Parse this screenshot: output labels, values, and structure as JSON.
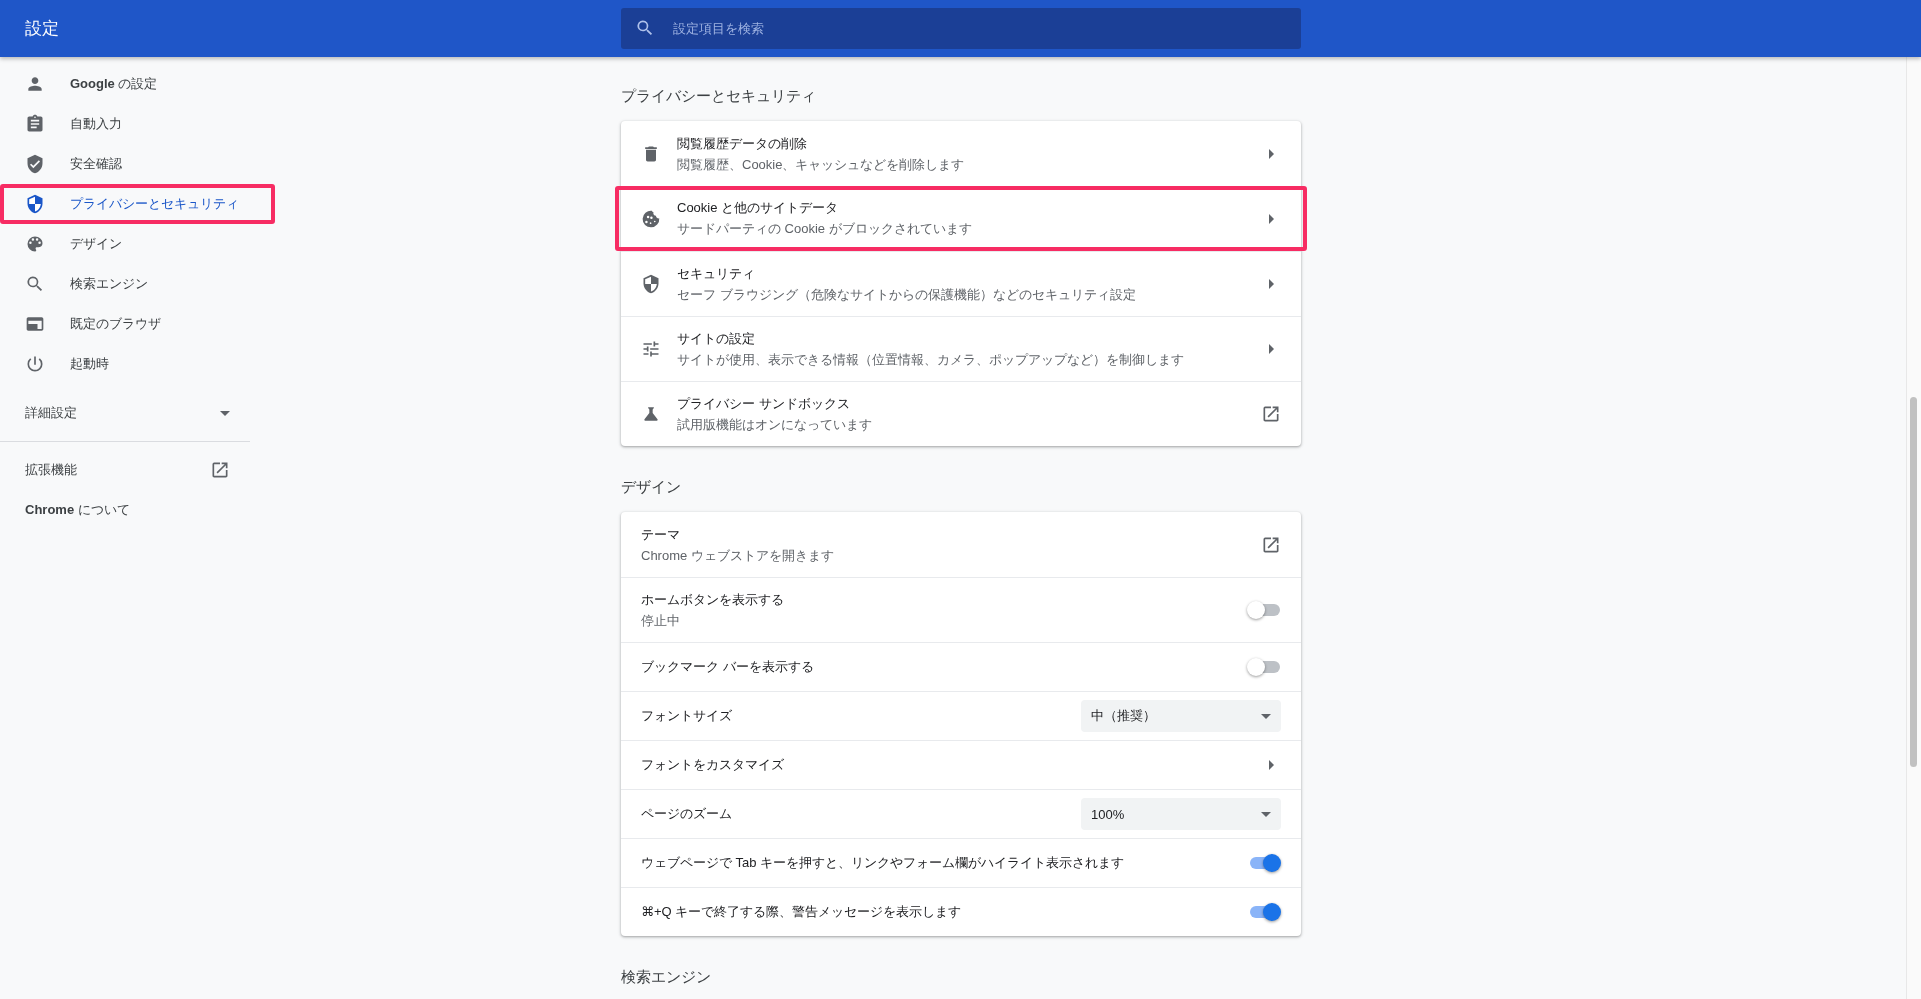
{
  "header": {
    "title": "設定",
    "search": {
      "placeholder": "設定項目を検索"
    }
  },
  "sidebar": {
    "items": [
      {
        "label": "**Google** の設定",
        "selected": false,
        "highlighted": false
      },
      {
        "label": "自動入力",
        "selected": false,
        "highlighted": false
      },
      {
        "label": "安全確認",
        "selected": false,
        "highlighted": false
      },
      {
        "label": "プライバシーとセキュリティ",
        "selected": true,
        "highlighted": true
      },
      {
        "label": "デザイン",
        "selected": false,
        "highlighted": false
      },
      {
        "label": "検索エンジン",
        "selected": false,
        "highlighted": false
      },
      {
        "label": "既定のブラウザ",
        "selected": false,
        "highlighted": false
      },
      {
        "label": "起動時",
        "selected": false,
        "highlighted": false
      }
    ],
    "advanced": {
      "label": "詳細設定",
      "expanded": false
    },
    "links": [
      {
        "label": "拡張機能",
        "external": true
      },
      {
        "label": "**Chrome** について",
        "external": false
      }
    ]
  },
  "sections": [
    {
      "title": "プライバシーとセキュリティ",
      "rows": [
        {
          "kind": "link",
          "title": "閲覧履歴データの削除",
          "subtitle": "閲覧履歴、Cookie、キャッシュなどを削除します",
          "highlighted": false
        },
        {
          "kind": "link",
          "title": "Cookie と他のサイトデータ",
          "subtitle": "サードパーティの Cookie がブロックされています",
          "highlighted": true
        },
        {
          "kind": "link",
          "title": "セキュリティ",
          "subtitle": "セーフ ブラウジング（危険なサイトからの保護機能）などのセキュリティ設定",
          "highlighted": false
        },
        {
          "kind": "link",
          "title": "サイトの設定",
          "subtitle": "サイトが使用、表示できる情報（位置情報、カメラ、ポップアップなど）を制御します",
          "highlighted": false
        },
        {
          "kind": "external",
          "title": "プライバシー サンドボックス",
          "subtitle": "試用版機能はオンになっています",
          "highlighted": false
        }
      ]
    },
    {
      "title": "デザイン",
      "rows": [
        {
          "kind": "external",
          "title": "テーマ",
          "subtitle": "Chrome ウェブストアを開きます"
        },
        {
          "kind": "toggle",
          "title": "ホームボタンを表示する",
          "subtitle": "停止中",
          "on": false
        },
        {
          "kind": "toggle",
          "title": "ブックマーク バーを表示する",
          "on": false
        },
        {
          "kind": "select",
          "title": "フォントサイズ",
          "value": "中（推奨）"
        },
        {
          "kind": "link",
          "title": "フォントをカスタマイズ"
        },
        {
          "kind": "select",
          "title": "ページのズーム",
          "value": "100%"
        },
        {
          "kind": "toggle",
          "title": "ウェブページで Tab キーを押すと、リンクやフォーム欄がハイライト表示されます",
          "on": true
        },
        {
          "kind": "toggle",
          "title": "⌘+Q キーで終了する際、警告メッセージを表示します",
          "on": true
        }
      ]
    },
    {
      "title": "検索エンジン"
    }
  ]
}
